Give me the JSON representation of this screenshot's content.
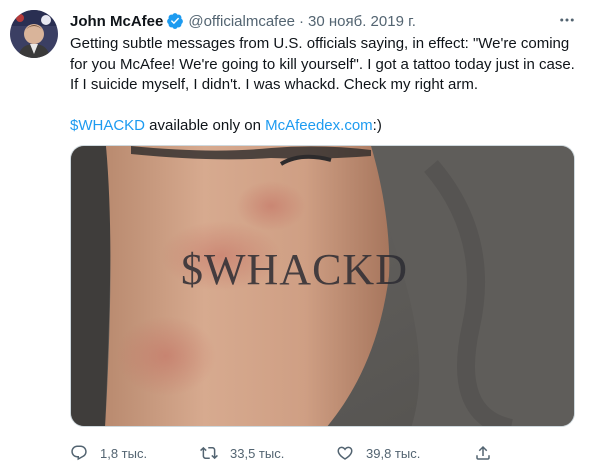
{
  "tweet": {
    "author_name": "John McAfee",
    "handle": "@officialmcafee",
    "separator": "·",
    "date": "30 нояб. 2019 г.",
    "text_line1": "Getting subtle messages from U.S. officials saying, in effect: \"We're coming for you McAfee! We're going to kill yourself\". I got a tattoo today just in case. If I suicide myself, I didn't. I was whackd. Check my right arm.",
    "cashtag": "$WHACKD",
    "text_middle": " available only on ",
    "link": "McAfeedex.com",
    "text_end": ":)",
    "tattoo_text": "$WHACKD"
  },
  "actions": {
    "reply_count": "1,8 тыс.",
    "retweet_count": "33,5 тыс.",
    "like_count": "39,8 тыс."
  },
  "icons": {
    "verified": "verified-badge-icon",
    "more": "more-icon",
    "reply": "reply-icon",
    "retweet": "retweet-icon",
    "like": "like-icon",
    "share": "share-icon"
  },
  "colors": {
    "link": "#1d9bf0",
    "secondary_text": "#536471",
    "primary_text": "#0f1419"
  }
}
